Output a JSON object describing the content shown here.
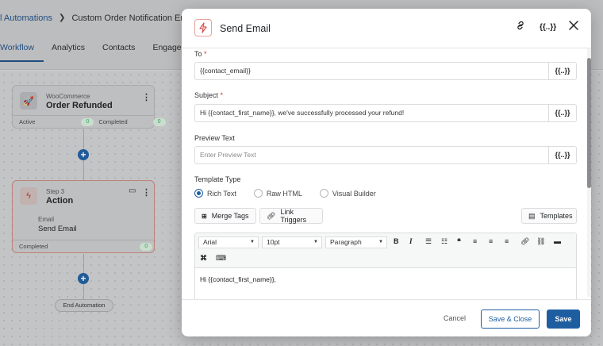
{
  "app": {
    "breadcrumb": {
      "root": "l Automations",
      "current": "Custom Order Notification Email"
    },
    "tabs": [
      "Workflow",
      "Analytics",
      "Contacts",
      "Engagements"
    ],
    "active_tab": "Workflow"
  },
  "canvas": {
    "trigger": {
      "category": "WooCommerce",
      "title": "Order Refunded",
      "active_label": "Active",
      "active_count": "0",
      "completed_label": "Completed",
      "completed_count": "0"
    },
    "step": {
      "step_label": "Step 3",
      "title": "Action",
      "sub_label": "Email",
      "sub_title": "Send Email",
      "completed_label": "Completed",
      "completed_count": "0"
    },
    "end_label": "End Automation"
  },
  "modal": {
    "title": "Send Email",
    "to": {
      "label": "To",
      "value": "{{contact_email}}"
    },
    "subject": {
      "label": "Subject",
      "value": "Hi {{contact_first_name}}, we've successfully processed your refund!"
    },
    "preview": {
      "label": "Preview Text",
      "placeholder": "Enter Preview Text"
    },
    "token_label": "{{..}}",
    "template_type": {
      "label": "Template Type",
      "options": [
        "Rich Text",
        "Raw HTML",
        "Visual Builder"
      ],
      "selected": "Rich Text"
    },
    "buttons": {
      "merge_tags": "Merge Tags",
      "link_triggers": "Link Triggers",
      "templates": "Templates"
    },
    "editor": {
      "font": "Arial",
      "size": "10pt",
      "format": "Paragraph",
      "content": "Hi {{contact_first_name}},"
    },
    "footer": {
      "cancel": "Cancel",
      "save_close": "Save & Close",
      "save": "Save"
    }
  },
  "colors": {
    "primary": "#1e5ea0",
    "danger": "#d63638",
    "accent_bolt": "#d9534f"
  }
}
